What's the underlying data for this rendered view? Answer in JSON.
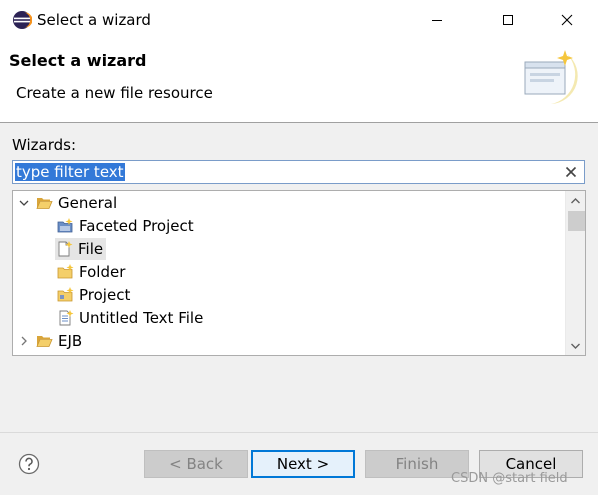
{
  "window": {
    "title": "Select a wizard"
  },
  "banner": {
    "title": "Select a wizard",
    "description": "Create a new file resource"
  },
  "wizards_label": "Wizards:",
  "filter": {
    "value": "type filter text"
  },
  "tree": {
    "items": [
      {
        "label": "General",
        "icon": "folder-open-icon",
        "expanded": true
      },
      {
        "label": "Faceted Project",
        "icon": "faceted-project-icon"
      },
      {
        "label": "File",
        "icon": "new-file-icon",
        "selected": true
      },
      {
        "label": "Folder",
        "icon": "new-folder-icon"
      },
      {
        "label": "Project",
        "icon": "new-project-icon"
      },
      {
        "label": "Untitled Text File",
        "icon": "text-file-icon"
      },
      {
        "label": "EJB",
        "icon": "folder-icon",
        "expanded": false
      }
    ]
  },
  "buttons": {
    "back": "< Back",
    "next": "Next >",
    "finish": "Finish",
    "cancel": "Cancel"
  },
  "watermark": "CSDN @start field",
  "colors": {
    "selection": "#3379d8",
    "default_button_border": "#0078d7",
    "folder": "#e8b84a"
  }
}
